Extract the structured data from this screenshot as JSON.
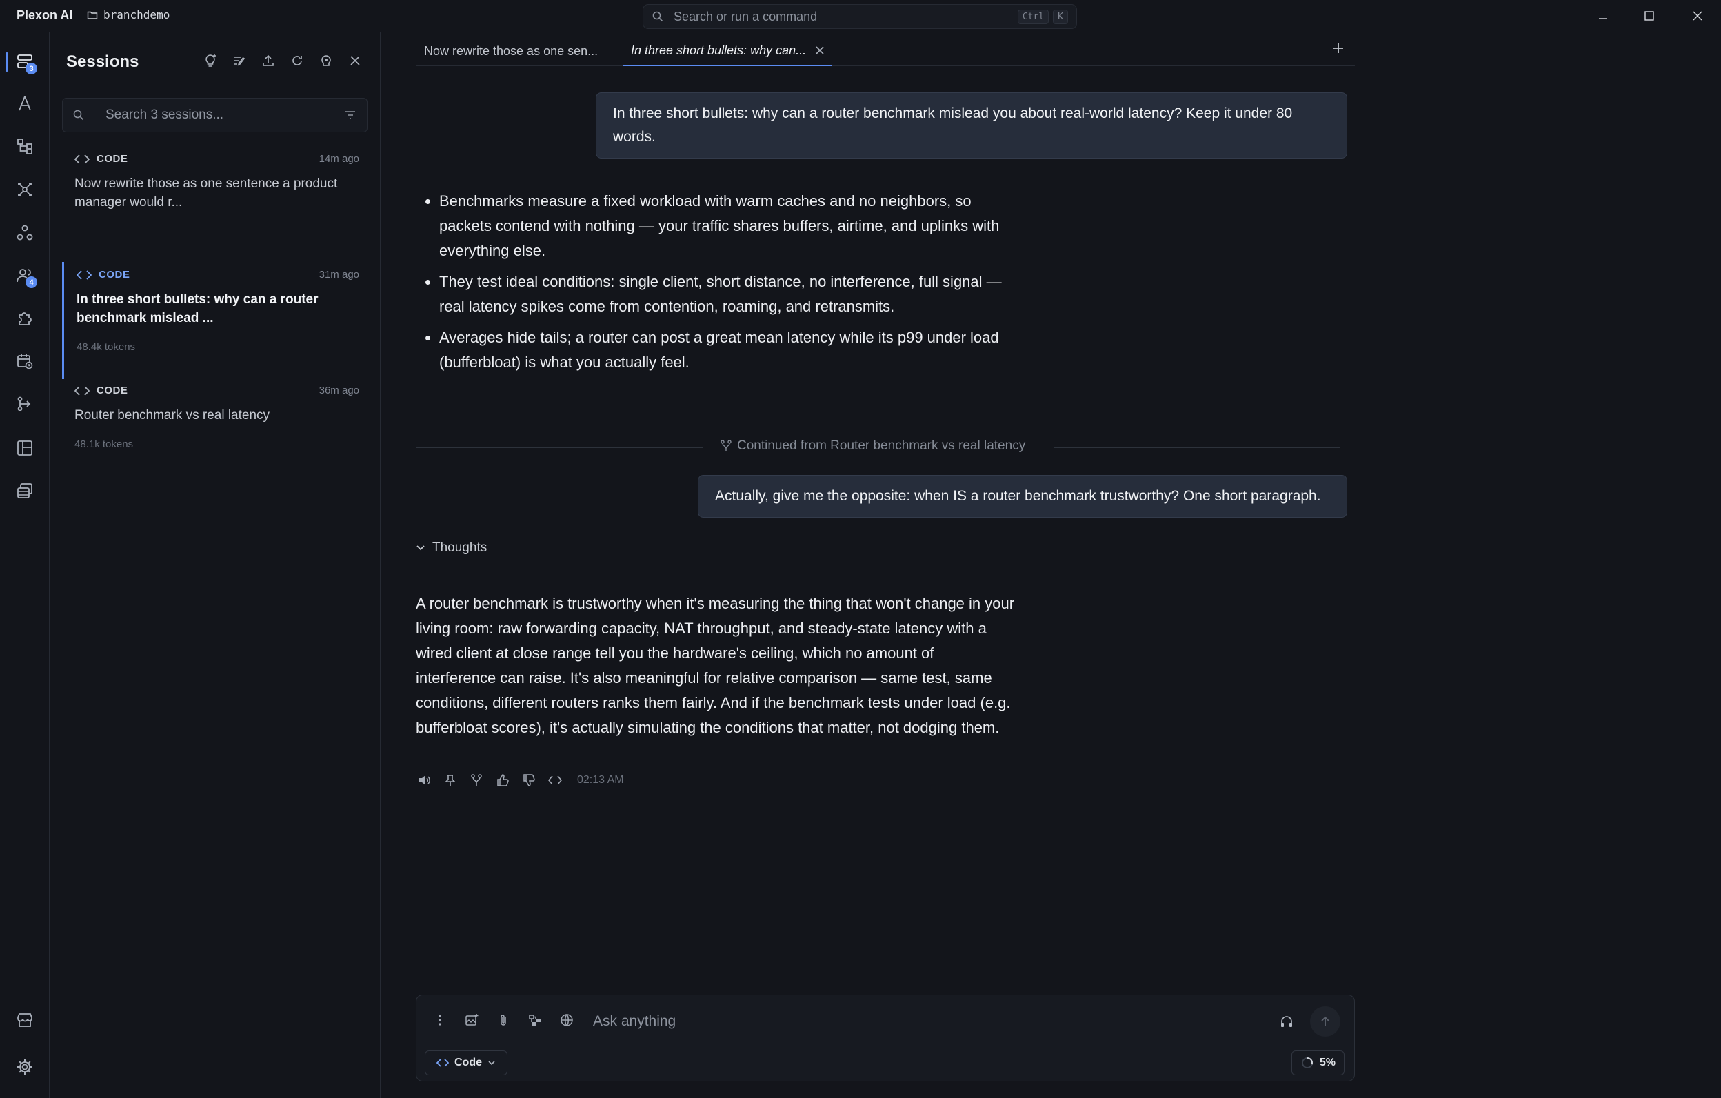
{
  "app": {
    "name": "Plexon AI",
    "project": "branchdemo"
  },
  "command_bar": {
    "placeholder": "Search or run a command",
    "shortcut_ctrl": "Ctrl",
    "shortcut_key": "K"
  },
  "rail": {
    "sessions_badge": "3",
    "agents_badge": "4"
  },
  "sessions_panel": {
    "title": "Sessions",
    "search_placeholder": "Search 3 sessions...",
    "items": [
      {
        "kind": "CODE",
        "time": "14m ago",
        "title": "Now rewrite those as one sentence a product manager would r...",
        "tokens": ""
      },
      {
        "kind": "CODE",
        "time": "31m ago",
        "title": "In three short bullets: why can a router benchmark mislead ...",
        "tokens": "48.4k tokens"
      },
      {
        "kind": "CODE",
        "time": "36m ago",
        "title": "Router benchmark vs real latency",
        "tokens": "48.1k tokens"
      }
    ]
  },
  "tabs": [
    {
      "label": "Now rewrite those as one sen..."
    },
    {
      "label": "In three short bullets: why can..."
    }
  ],
  "chat": {
    "user_message_1": "In three short bullets: why can a router benchmark mislead you about real-world latency? Keep it under 80 words.",
    "bullets": [
      "Benchmarks measure a fixed workload with warm caches and no neighbors, so packets contend with nothing — your traffic shares buffers, airtime, and uplinks with everything else.",
      "They test ideal conditions: single client, short distance, no interference, full signal — real latency spikes come from contention, roaming, and retransmits.",
      "Averages hide tails; a router can post a great mean latency while its p99 under load (bufferbloat) is what you actually feel."
    ],
    "continued_from": "Continued from Router benchmark vs real latency",
    "user_message_2": "Actually, give me the opposite: when IS a router benchmark trustworthy? One short paragraph.",
    "thoughts_label": "Thoughts",
    "answer_2": "A router benchmark is trustworthy when it's measuring the thing that won't change in your living room: raw forwarding capacity, NAT throughput, and steady-state latency with a wired client at close range tell you the hardware's ceiling, which no amount of interference can raise. It's also meaningful for relative comparison — same test, same conditions, different routers ranks them fairly. And if the benchmark tests under load (e.g. bufferbloat scores), it's actually simulating the conditions that matter, not dodging them.",
    "answer_time": "02:13 AM"
  },
  "composer": {
    "placeholder": "Ask anything",
    "mode": "Code",
    "usage": "5%"
  }
}
